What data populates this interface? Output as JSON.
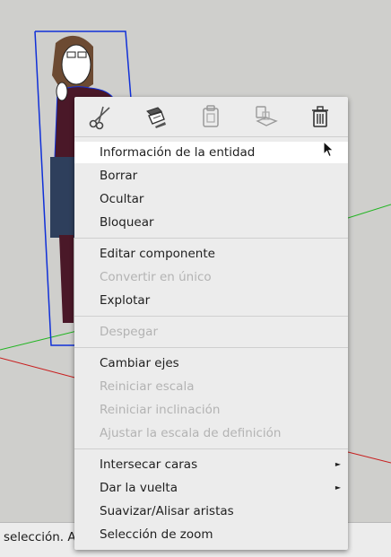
{
  "status": {
    "text": "selección. Ar"
  },
  "toolbar": {
    "icons": [
      "scissors-icon",
      "copy-icon",
      "paste-icon",
      "paste-in-place-icon",
      "trash-icon"
    ]
  },
  "menu": {
    "items": [
      {
        "id": "entity-info",
        "label": "Información de la entidad",
        "enabled": true,
        "highlighted": true
      },
      {
        "id": "erase",
        "label": "Borrar",
        "enabled": true
      },
      {
        "id": "hide",
        "label": "Ocultar",
        "enabled": true
      },
      {
        "id": "lock",
        "label": "Bloquear",
        "enabled": true
      },
      {
        "id": "edit-component",
        "label": "Editar componente",
        "enabled": true
      },
      {
        "id": "make-unique",
        "label": "Convertir en único",
        "enabled": false
      },
      {
        "id": "explode",
        "label": "Explotar",
        "enabled": true
      },
      {
        "id": "unglue",
        "label": "Despegar",
        "enabled": false
      },
      {
        "id": "change-axes",
        "label": "Cambiar ejes",
        "enabled": true
      },
      {
        "id": "reset-scale",
        "label": "Reiniciar escala",
        "enabled": false
      },
      {
        "id": "reset-skew",
        "label": "Reiniciar inclinación",
        "enabled": false
      },
      {
        "id": "scale-definition",
        "label": "Ajustar la escala de definición",
        "enabled": false
      },
      {
        "id": "intersect-faces",
        "label": "Intersecar caras",
        "enabled": true,
        "submenu": true
      },
      {
        "id": "flip-along",
        "label": "Dar la vuelta",
        "enabled": true,
        "submenu": true
      },
      {
        "id": "soften-edges",
        "label": "Suavizar/Alisar aristas",
        "enabled": true
      },
      {
        "id": "zoom-selection",
        "label": "Selección de zoom",
        "enabled": true
      }
    ],
    "submenu_arrow": "►"
  },
  "colors": {
    "selection_box": "#1030d8",
    "red_axis": "#c81e1e",
    "green_axis": "#22b522",
    "menu_bg": "#ececec",
    "menu_highlight": "#ffffff",
    "disabled_text": "#b3b3b3"
  }
}
